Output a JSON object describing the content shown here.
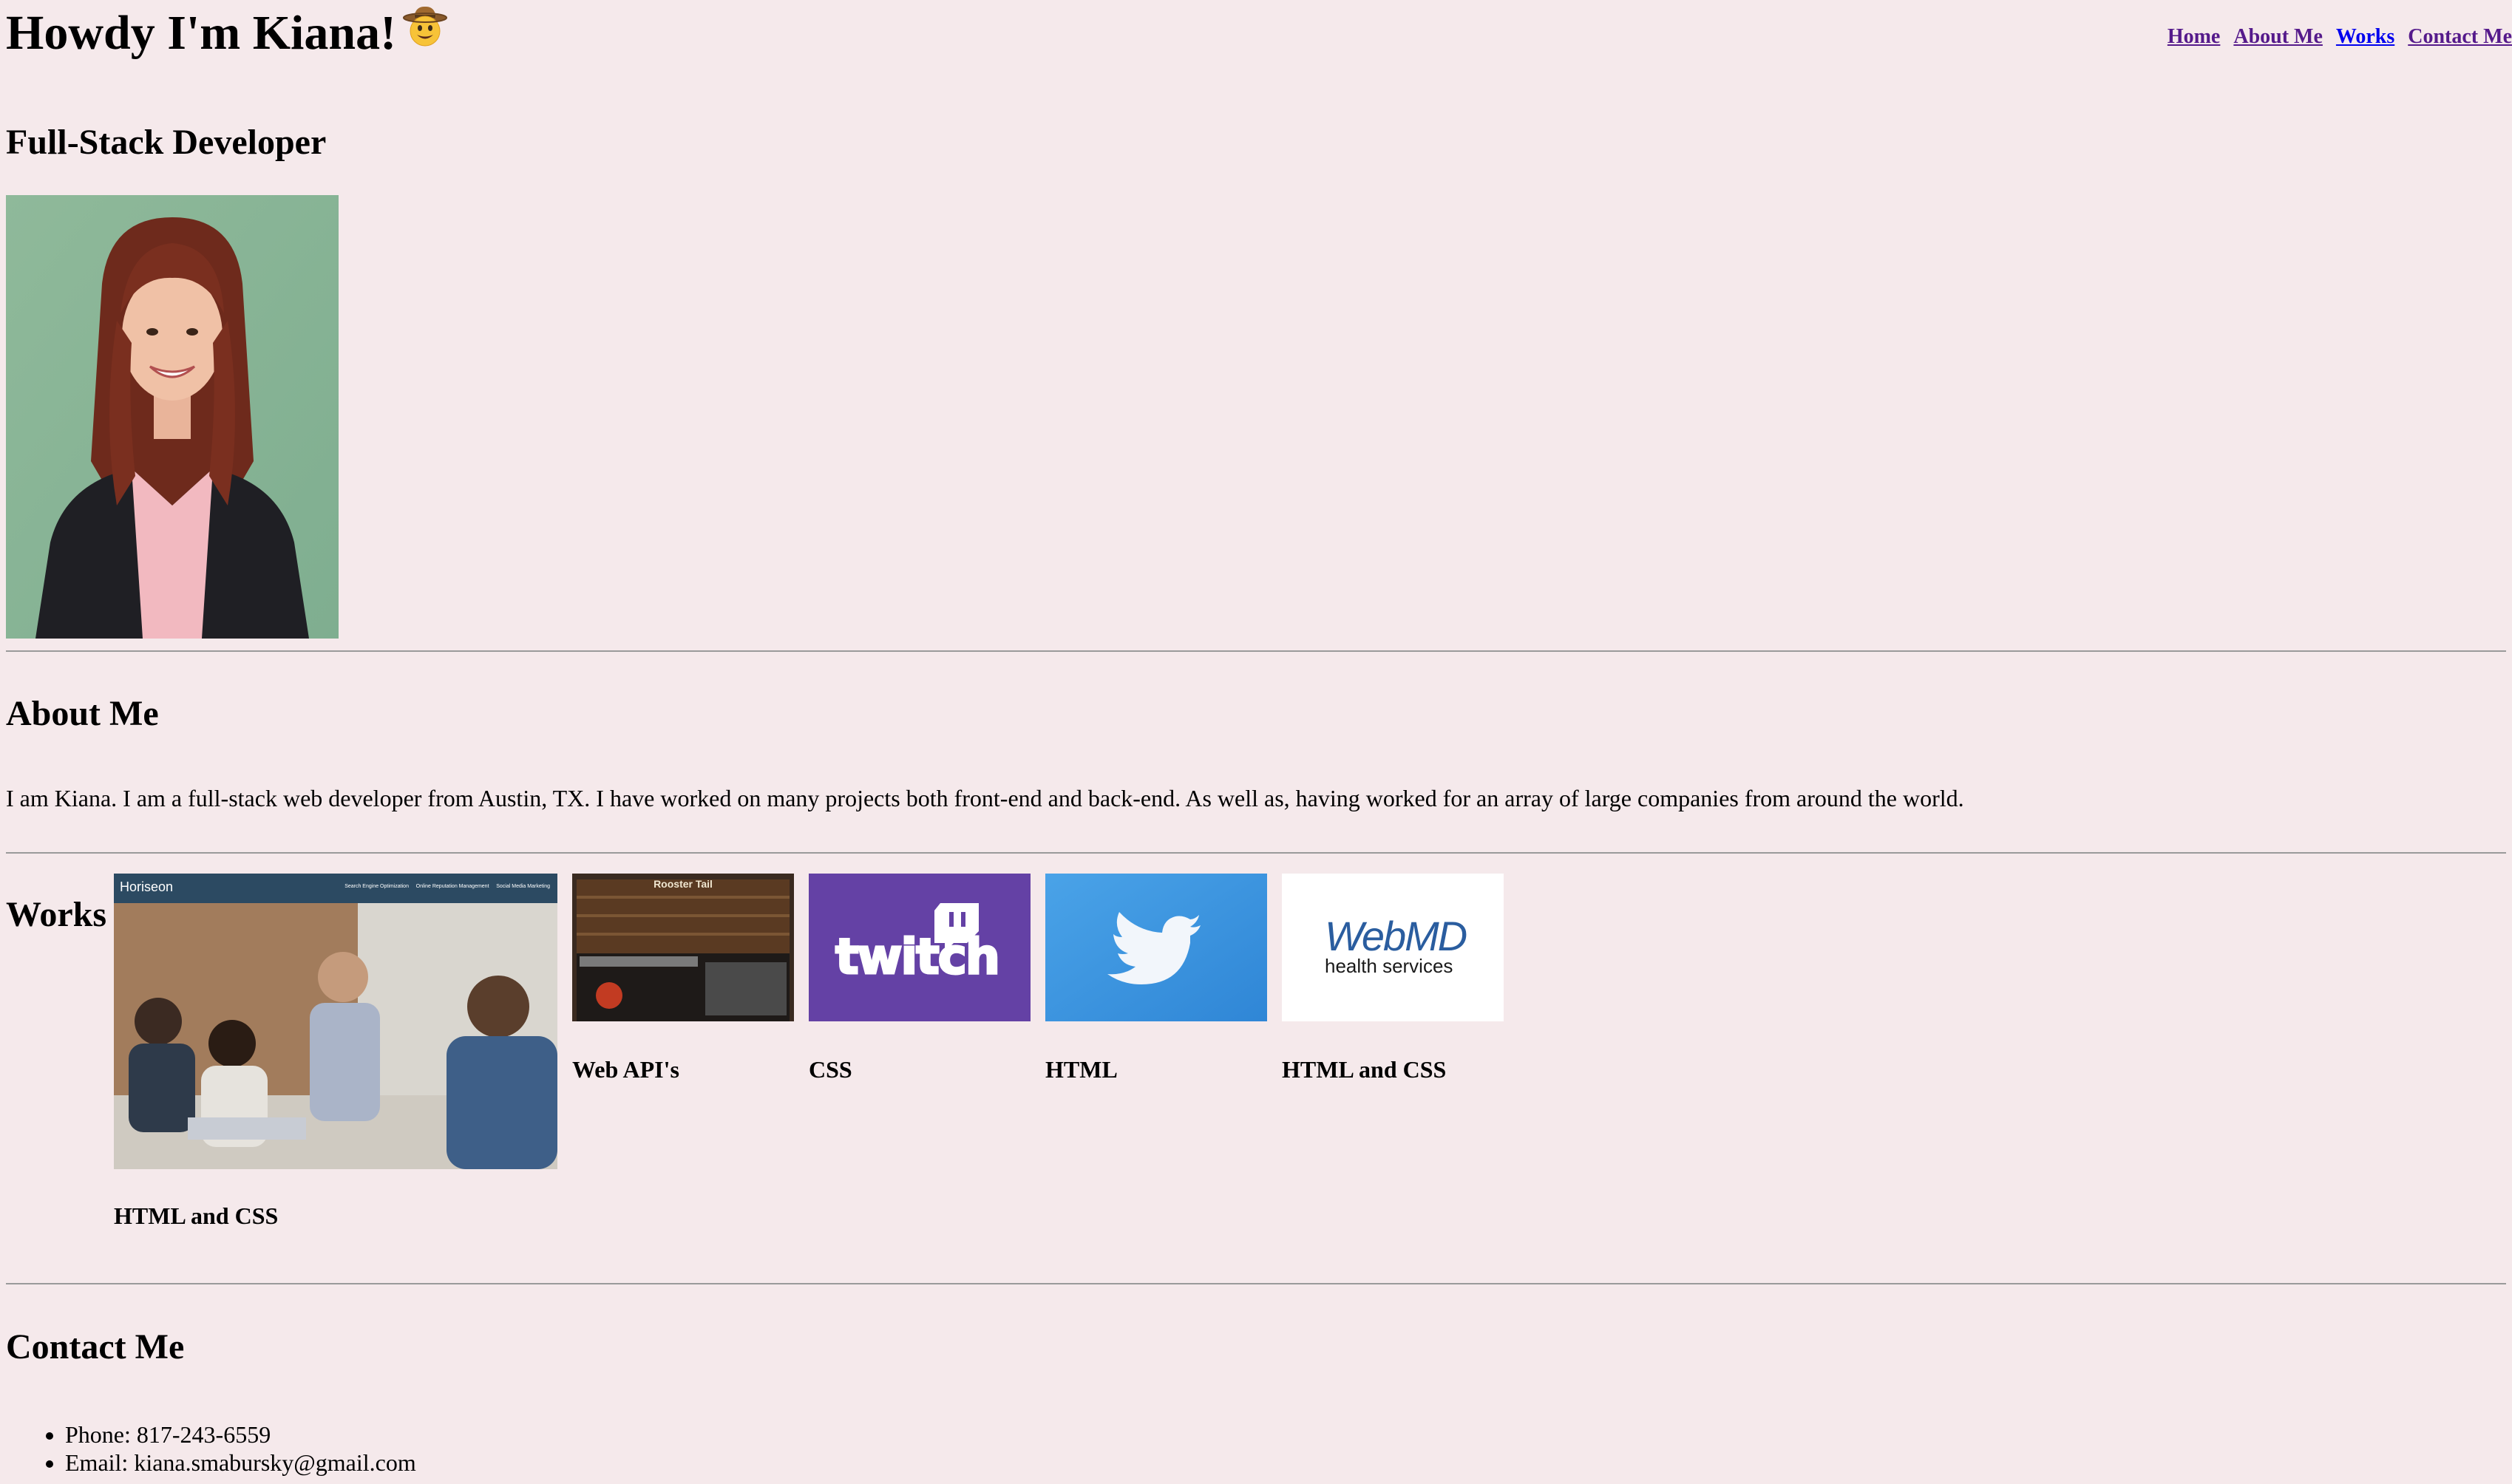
{
  "header": {
    "title": "Howdy I'm Kiana!",
    "emoji_icon": "cowboy-hat-face-icon"
  },
  "nav": {
    "items": [
      {
        "label": "Home"
      },
      {
        "label": "About Me"
      },
      {
        "label": "Works"
      },
      {
        "label": "Contact Me"
      }
    ]
  },
  "hero": {
    "subtitle": "Full-Stack Developer"
  },
  "about": {
    "heading": "About Me",
    "text": "I am Kiana. I am a full-stack web developer from Austin, TX. I have worked on many projects both front-end and back-end. As well as, having worked for an array of large companies from around the world."
  },
  "works": {
    "heading": "Works",
    "items": [
      {
        "label": "HTML and CSS",
        "thumb_text": "Horiseon",
        "thumb_nav": "Search Engine Optimization     Online Reputation Management     Social Media Marketing"
      },
      {
        "label": "Web API's",
        "thumb_text": "Rooster Tail"
      },
      {
        "label": "CSS",
        "thumb_text": "twitch"
      },
      {
        "label": "HTML"
      },
      {
        "label": "HTML and CSS",
        "thumb_text": "WebMD",
        "thumb_sub": "health services"
      }
    ]
  },
  "contact": {
    "heading": "Contact Me",
    "items": [
      {
        "text": "Phone: 817-243-6559"
      },
      {
        "text": "Email: kiana.smabursky@gmail.com"
      }
    ]
  },
  "colors": {
    "background": "#f5e9eb",
    "visited_link": "#551a8b",
    "link": "#0000ee",
    "twitch_purple": "#6441a5",
    "twitter_blue": "#3b95dd"
  }
}
